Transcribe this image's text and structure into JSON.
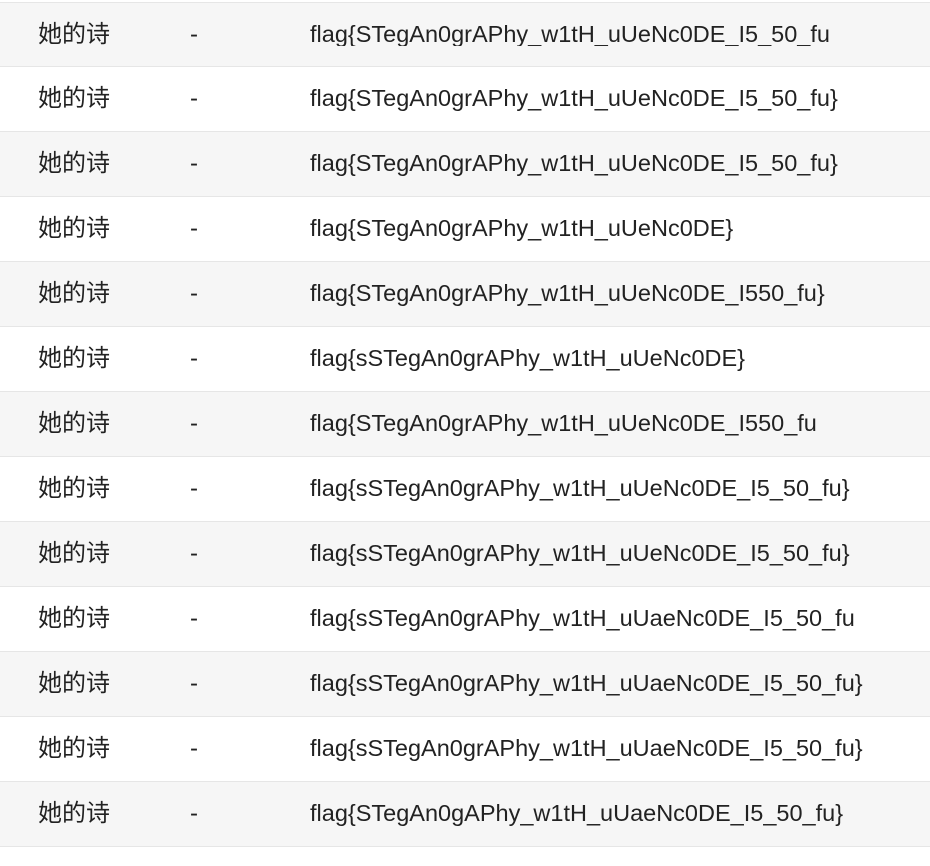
{
  "table": {
    "rows": [
      {
        "name": "她的诗",
        "dash": "-",
        "value": "flag{STegAn0grAPhy_w1tH_uUeNc0DE_I5_50_fu"
      },
      {
        "name": "她的诗",
        "dash": "-",
        "value": "flag{STegAn0grAPhy_w1tH_uUeNc0DE_I5_50_fu}"
      },
      {
        "name": "她的诗",
        "dash": "-",
        "value": "flag{STegAn0grAPhy_w1tH_uUeNc0DE_I5_50_fu}"
      },
      {
        "name": "她的诗",
        "dash": "-",
        "value": "flag{STegAn0grAPhy_w1tH_uUeNc0DE}"
      },
      {
        "name": "她的诗",
        "dash": "-",
        "value": "flag{STegAn0grAPhy_w1tH_uUeNc0DE_I550_fu}"
      },
      {
        "name": "她的诗",
        "dash": "-",
        "value": "flag{sSTegAn0grAPhy_w1tH_uUeNc0DE}"
      },
      {
        "name": "她的诗",
        "dash": "-",
        "value": "flag{STegAn0grAPhy_w1tH_uUeNc0DE_I550_fu"
      },
      {
        "name": "她的诗",
        "dash": "-",
        "value": "flag{sSTegAn0grAPhy_w1tH_uUeNc0DE_I5_50_fu}"
      },
      {
        "name": "她的诗",
        "dash": "-",
        "value": "flag{sSTegAn0grAPhy_w1tH_uUeNc0DE_I5_50_fu}"
      },
      {
        "name": "她的诗",
        "dash": "-",
        "value": "flag{sSTegAn0grAPhy_w1tH_uUaeNc0DE_I5_50_fu"
      },
      {
        "name": "她的诗",
        "dash": "-",
        "value": "flag{sSTegAn0grAPhy_w1tH_uUaeNc0DE_I5_50_fu}"
      },
      {
        "name": "她的诗",
        "dash": "-",
        "value": "flag{sSTegAn0grAPhy_w1tH_uUaeNc0DE_I5_50_fu}"
      },
      {
        "name": "她的诗",
        "dash": "-",
        "value": "flag{STegAn0gAPhy_w1tH_uUaeNc0DE_I5_50_fu}"
      }
    ]
  }
}
